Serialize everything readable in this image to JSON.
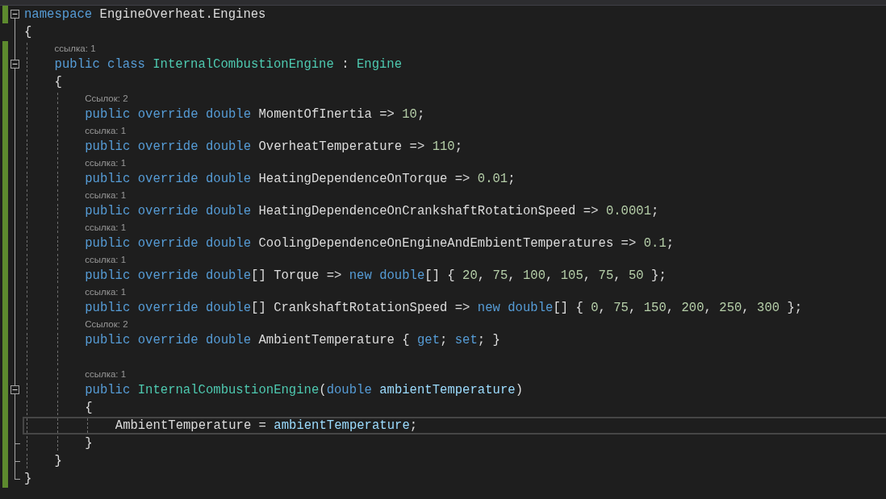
{
  "editor": {
    "lines": [
      {
        "kind": "fold_start",
        "expanded": true,
        "changed": true,
        "current": false,
        "tokens": [
          {
            "t": "namespace",
            "kind": "kw"
          },
          {
            "t": " EngineOverheat.Engines",
            "kind": "plain"
          }
        ]
      },
      {
        "kind": "code",
        "changed": false,
        "current": false,
        "tokens": [
          {
            "t": "{",
            "kind": "plain"
          }
        ],
        "children": [
          {
            "kind": "lens",
            "changed": true,
            "text": "ссылка: 1"
          },
          {
            "kind": "fold_start",
            "expanded": true,
            "changed": true,
            "current": false,
            "tokens": [
              {
                "t": "public class ",
                "kind": "kw"
              },
              {
                "t": "InternalCombustionEngine",
                "kind": "type"
              },
              {
                "t": " : ",
                "kind": "plain"
              },
              {
                "t": "Engine",
                "kind": "type"
              }
            ]
          },
          {
            "kind": "code",
            "changed": true,
            "current": false,
            "tokens": [
              {
                "t": "{",
                "kind": "plain"
              }
            ],
            "children": [
              {
                "kind": "lens",
                "changed": true,
                "text": "Ссылок: 2"
              },
              {
                "kind": "code",
                "changed": true,
                "current": false,
                "tokens": [
                  {
                    "t": "public override double",
                    "kind": "kw"
                  },
                  {
                    "t": " MomentOfInertia => ",
                    "kind": "plain"
                  },
                  {
                    "t": "10",
                    "kind": "num"
                  },
                  {
                    "t": ";",
                    "kind": "plain"
                  }
                ]
              },
              {
                "kind": "lens",
                "changed": true,
                "text": "ссылка: 1"
              },
              {
                "kind": "code",
                "changed": true,
                "current": false,
                "tokens": [
                  {
                    "t": "public override double",
                    "kind": "kw"
                  },
                  {
                    "t": " OverheatTemperature => ",
                    "kind": "plain"
                  },
                  {
                    "t": "110",
                    "kind": "num"
                  },
                  {
                    "t": ";",
                    "kind": "plain"
                  }
                ]
              },
              {
                "kind": "lens",
                "changed": true,
                "text": "ссылка: 1"
              },
              {
                "kind": "code",
                "changed": true,
                "current": false,
                "tokens": [
                  {
                    "t": "public override double",
                    "kind": "kw"
                  },
                  {
                    "t": " HeatingDependenceOnTorque => ",
                    "kind": "plain"
                  },
                  {
                    "t": "0.01",
                    "kind": "num"
                  },
                  {
                    "t": ";",
                    "kind": "plain"
                  }
                ]
              },
              {
                "kind": "lens",
                "changed": true,
                "text": "ссылка: 1"
              },
              {
                "kind": "code",
                "changed": true,
                "current": false,
                "tokens": [
                  {
                    "t": "public override double",
                    "kind": "kw"
                  },
                  {
                    "t": " HeatingDependenceOnCrankshaftRotationSpeed => ",
                    "kind": "plain"
                  },
                  {
                    "t": "0.0001",
                    "kind": "num"
                  },
                  {
                    "t": ";",
                    "kind": "plain"
                  }
                ]
              },
              {
                "kind": "lens",
                "changed": true,
                "text": "ссылка: 1"
              },
              {
                "kind": "code",
                "changed": true,
                "current": false,
                "tokens": [
                  {
                    "t": "public override double",
                    "kind": "kw"
                  },
                  {
                    "t": " CoolingDependenceOnEngineAndEmbientTemperatures => ",
                    "kind": "plain"
                  },
                  {
                    "t": "0.1",
                    "kind": "num"
                  },
                  {
                    "t": ";",
                    "kind": "plain"
                  }
                ]
              },
              {
                "kind": "lens",
                "changed": true,
                "text": "ссылка: 1"
              },
              {
                "kind": "code",
                "changed": true,
                "current": false,
                "tokens": [
                  {
                    "t": "public override double",
                    "kind": "kw"
                  },
                  {
                    "t": "[] Torque => ",
                    "kind": "plain"
                  },
                  {
                    "t": "new double",
                    "kind": "kw"
                  },
                  {
                    "t": "[] { ",
                    "kind": "plain"
                  },
                  {
                    "t": "20",
                    "kind": "num"
                  },
                  {
                    "t": ", ",
                    "kind": "plain"
                  },
                  {
                    "t": "75",
                    "kind": "num"
                  },
                  {
                    "t": ", ",
                    "kind": "plain"
                  },
                  {
                    "t": "100",
                    "kind": "num"
                  },
                  {
                    "t": ", ",
                    "kind": "plain"
                  },
                  {
                    "t": "105",
                    "kind": "num"
                  },
                  {
                    "t": ", ",
                    "kind": "plain"
                  },
                  {
                    "t": "75",
                    "kind": "num"
                  },
                  {
                    "t": ", ",
                    "kind": "plain"
                  },
                  {
                    "t": "50",
                    "kind": "num"
                  },
                  {
                    "t": " };",
                    "kind": "plain"
                  }
                ]
              },
              {
                "kind": "lens",
                "changed": true,
                "text": "ссылка: 1"
              },
              {
                "kind": "code",
                "changed": true,
                "current": false,
                "tokens": [
                  {
                    "t": "public override double",
                    "kind": "kw"
                  },
                  {
                    "t": "[] CrankshaftRotationSpeed => ",
                    "kind": "plain"
                  },
                  {
                    "t": "new double",
                    "kind": "kw"
                  },
                  {
                    "t": "[] { ",
                    "kind": "plain"
                  },
                  {
                    "t": "0",
                    "kind": "num"
                  },
                  {
                    "t": ", ",
                    "kind": "plain"
                  },
                  {
                    "t": "75",
                    "kind": "num"
                  },
                  {
                    "t": ", ",
                    "kind": "plain"
                  },
                  {
                    "t": "150",
                    "kind": "num"
                  },
                  {
                    "t": ", ",
                    "kind": "plain"
                  },
                  {
                    "t": "200",
                    "kind": "num"
                  },
                  {
                    "t": ", ",
                    "kind": "plain"
                  },
                  {
                    "t": "250",
                    "kind": "num"
                  },
                  {
                    "t": ", ",
                    "kind": "plain"
                  },
                  {
                    "t": "300",
                    "kind": "num"
                  },
                  {
                    "t": " };",
                    "kind": "plain"
                  }
                ]
              },
              {
                "kind": "lens",
                "changed": true,
                "text": "Ссылок: 2"
              },
              {
                "kind": "code",
                "changed": true,
                "current": false,
                "tokens": [
                  {
                    "t": "public override double",
                    "kind": "kw"
                  },
                  {
                    "t": " AmbientTemperature { ",
                    "kind": "plain"
                  },
                  {
                    "t": "get",
                    "kind": "kw"
                  },
                  {
                    "t": "; ",
                    "kind": "plain"
                  },
                  {
                    "t": "set",
                    "kind": "kw"
                  },
                  {
                    "t": "; }",
                    "kind": "plain"
                  }
                ]
              },
              {
                "kind": "blank",
                "changed": true
              },
              {
                "kind": "lens",
                "changed": true,
                "text": "ссылка: 1"
              },
              {
                "kind": "fold_start",
                "expanded": true,
                "changed": true,
                "current": false,
                "tokens": [
                  {
                    "t": "public ",
                    "kind": "kw"
                  },
                  {
                    "t": "InternalCombustionEngine",
                    "kind": "type"
                  },
                  {
                    "t": "(",
                    "kind": "plain"
                  },
                  {
                    "t": "double ",
                    "kind": "kw"
                  },
                  {
                    "t": "ambientTemperature",
                    "kind": "param"
                  },
                  {
                    "t": ")",
                    "kind": "plain"
                  }
                ]
              },
              {
                "kind": "code",
                "changed": true,
                "current": false,
                "tokens": [
                  {
                    "t": "{",
                    "kind": "plain"
                  }
                ],
                "children": [
                  {
                    "kind": "code",
                    "changed": true,
                    "current": true,
                    "tokens": [
                      {
                        "t": "AmbientTemperature = ",
                        "kind": "plain"
                      },
                      {
                        "t": "ambientTemperature",
                        "kind": "param"
                      },
                      {
                        "t": ";",
                        "kind": "plain"
                      }
                    ]
                  }
                ]
              },
              {
                "kind": "fold_end",
                "changed": true,
                "current": false,
                "tokens": [
                  {
                    "t": "}",
                    "kind": "plain"
                  }
                ]
              }
            ]
          },
          {
            "kind": "fold_end",
            "changed": true,
            "current": false,
            "tokens": [
              {
                "t": "}",
                "kind": "plain"
              }
            ]
          }
        ]
      },
      {
        "kind": "fold_end",
        "changed": true,
        "current": false,
        "tokens": [
          {
            "t": "}",
            "kind": "plain"
          }
        ]
      }
    ]
  }
}
